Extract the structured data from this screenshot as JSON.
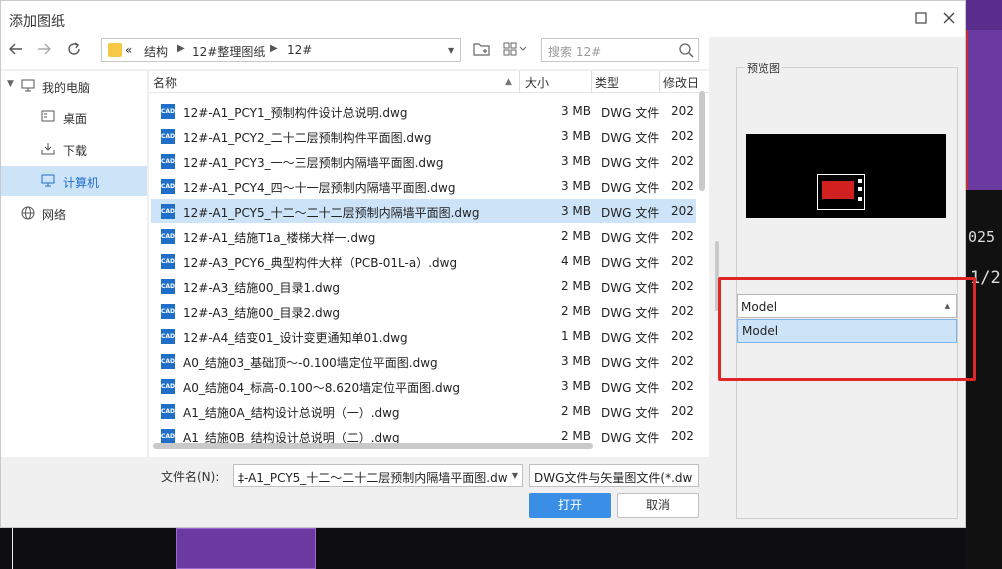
{
  "window": {
    "title": "添加图纸"
  },
  "address": {
    "prefix": "«",
    "crumbs": [
      "结构",
      "12#整理图纸",
      "12#"
    ]
  },
  "search": {
    "placeholder": "搜索 12#"
  },
  "tree": {
    "items": [
      {
        "label": "我的电脑",
        "icon": "computer-icon"
      },
      {
        "label": "桌面",
        "icon": "desktop-icon"
      },
      {
        "label": "下载",
        "icon": "download-icon"
      },
      {
        "label": "计算机",
        "icon": "computer-icon",
        "selected": true
      },
      {
        "label": "网络",
        "icon": "network-icon"
      }
    ]
  },
  "list": {
    "columns": [
      "名称",
      "大小",
      "类型",
      "修改日"
    ],
    "icon_label": "CAD",
    "files": [
      {
        "name": "12#-A1_PCY1_预制构件设计总说明.dwg",
        "size": "3 MB",
        "type": "DWG 文件",
        "date": "202"
      },
      {
        "name": "12#-A1_PCY2_二十二层预制构件平面图.dwg",
        "size": "3 MB",
        "type": "DWG 文件",
        "date": "202"
      },
      {
        "name": "12#-A1_PCY3_一～三层预制内隔墙平面图.dwg",
        "size": "3 MB",
        "type": "DWG 文件",
        "date": "202"
      },
      {
        "name": "12#-A1_PCY4_四～十一层预制内隔墙平面图.dwg",
        "size": "3 MB",
        "type": "DWG 文件",
        "date": "202"
      },
      {
        "name": "12#-A1_PCY5_十二～二十二层预制内隔墙平面图.dwg",
        "size": "3 MB",
        "type": "DWG 文件",
        "date": "202",
        "selected": true
      },
      {
        "name": "12#-A1_结施T1a_楼梯大样一.dwg",
        "size": "2 MB",
        "type": "DWG 文件",
        "date": "202"
      },
      {
        "name": "12#-A3_PCY6_典型构件大样（PCB-01L-a）.dwg",
        "size": "4 MB",
        "type": "DWG 文件",
        "date": "202"
      },
      {
        "name": "12#-A3_结施00_目录1.dwg",
        "size": "2 MB",
        "type": "DWG 文件",
        "date": "202"
      },
      {
        "name": "12#-A3_结施00_目录2.dwg",
        "size": "2 MB",
        "type": "DWG 文件",
        "date": "202"
      },
      {
        "name": "12#-A4_结变01_设计变更通知单01.dwg",
        "size": "1 MB",
        "type": "DWG 文件",
        "date": "202"
      },
      {
        "name": "A0_结施03_基础顶～-0.100墙定位平面图.dwg",
        "size": "3 MB",
        "type": "DWG 文件",
        "date": "202"
      },
      {
        "name": "A0_结施04_标高-0.100～8.620墙定位平面图.dwg",
        "size": "3 MB",
        "type": "DWG 文件",
        "date": "202"
      },
      {
        "name": "A1_结施0A_结构设计总说明（一）.dwg",
        "size": "2 MB",
        "type": "DWG 文件",
        "date": "202"
      },
      {
        "name": "A1_结施0B_结构设计总说明（二）.dwg",
        "size": "2 MB",
        "type": "DWG 文件",
        "date": "202"
      }
    ]
  },
  "footer": {
    "filename_label": "文件名(N):",
    "filename_value": "‡-A1_PCY5_十二～二十二层预制内隔墙平面图.dwg",
    "filetype_value": "DWG文件与矢量图文件(*.dw",
    "open_label": "打开",
    "cancel_label": "取消"
  },
  "preview": {
    "label": "预览图",
    "layout_selected": "Model",
    "layout_options": [
      "Model"
    ]
  },
  "background": {
    "num1": "025",
    "num2": "1/2"
  },
  "colors": {
    "accent": "#3a8ee6",
    "selection": "#cde3f8",
    "highlight_box": "#e02626",
    "cad_icon": "#1f6fc8"
  }
}
